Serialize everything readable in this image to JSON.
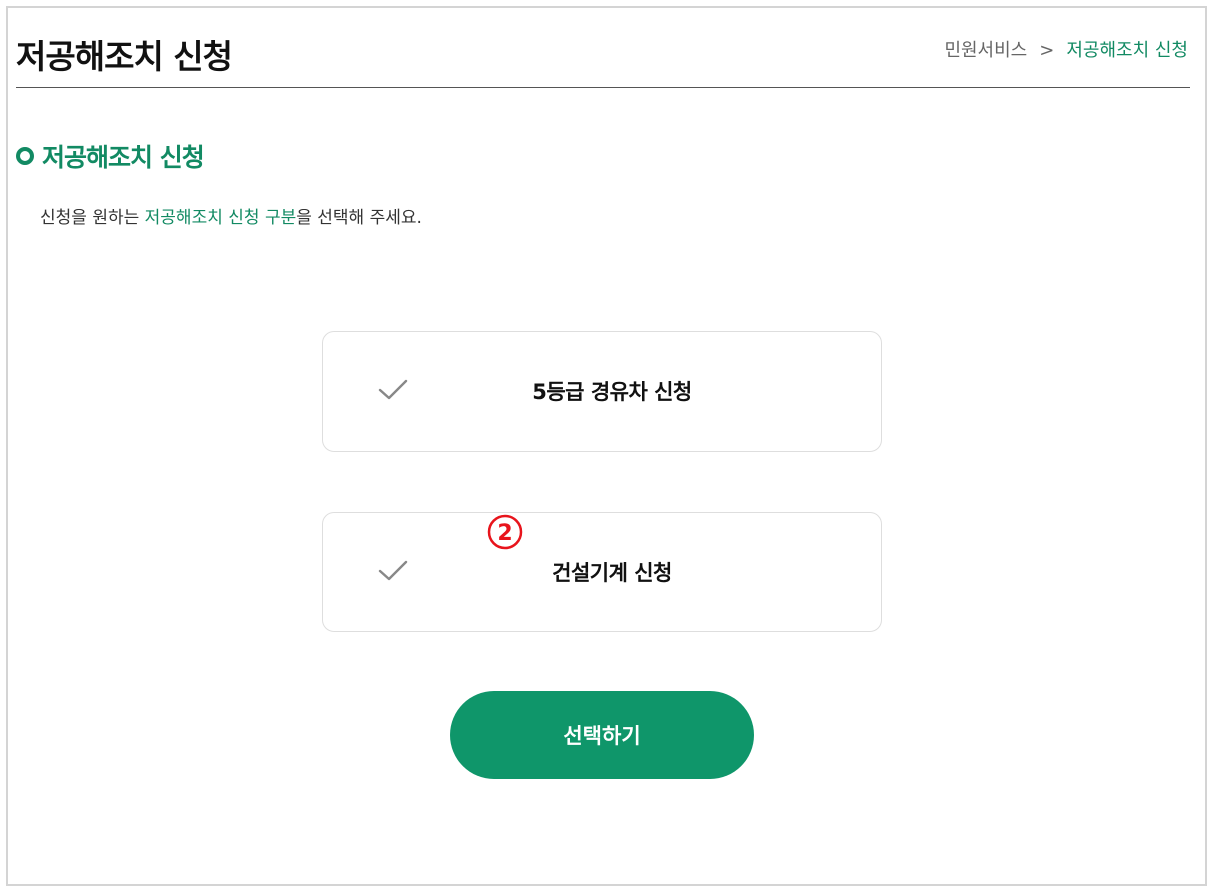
{
  "header": {
    "title": "저공해조치 신청",
    "breadcrumb": {
      "parent": "민원서비스",
      "separator": ">",
      "current": "저공해조치 신청"
    }
  },
  "section": {
    "title": "저공해조치 신청",
    "instruction_before": "신청을 원하는 ",
    "instruction_highlight": "저공해조치 신청 구분",
    "instruction_after": "을 선택해 주세요."
  },
  "options": [
    {
      "label": "5등급 경유차 신청",
      "icon": "check-icon"
    },
    {
      "label": "건설기계 신청",
      "icon": "check-icon"
    }
  ],
  "annotation": {
    "marker": "2",
    "color": "#e8141c"
  },
  "submit": {
    "label": "선택하기"
  },
  "colors": {
    "accent": "#128a63",
    "button": "#0f966a"
  }
}
